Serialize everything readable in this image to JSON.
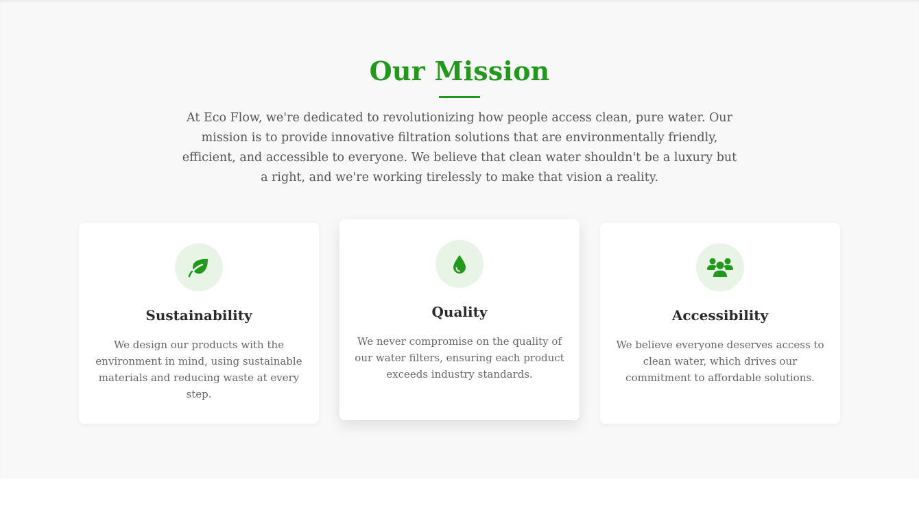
{
  "mission": {
    "title": "Our Mission",
    "description": "At Eco Flow, we're dedicated to revolutionizing how people access clean, pure water. Our mission is to provide innovative filtration solutions that are environmentally friendly, efficient, and accessible to everyone. We believe that clean water shouldn't be a luxury but a right, and we're working tirelessly to make that vision a reality."
  },
  "cards": [
    {
      "icon": "leaf-icon",
      "title": "Sustainability",
      "text": "We design our products with the environment in mind, using sustainable materials and reducing waste at every step."
    },
    {
      "icon": "water-drop-icon",
      "title": "Quality",
      "text": "We never compromise on the quality of our water filters, ensuring each product exceeds industry standards."
    },
    {
      "icon": "users-icon",
      "title": "Accessibility",
      "text": "We believe everyone deserves access to clean water, which drives our commitment to affordable solutions."
    }
  ],
  "colors": {
    "accent": "#22991c",
    "icon_background": "#e8f5e6",
    "section_background": "#f8f8f8",
    "heading_text": "#2a2a2a",
    "body_text": "#555555"
  }
}
